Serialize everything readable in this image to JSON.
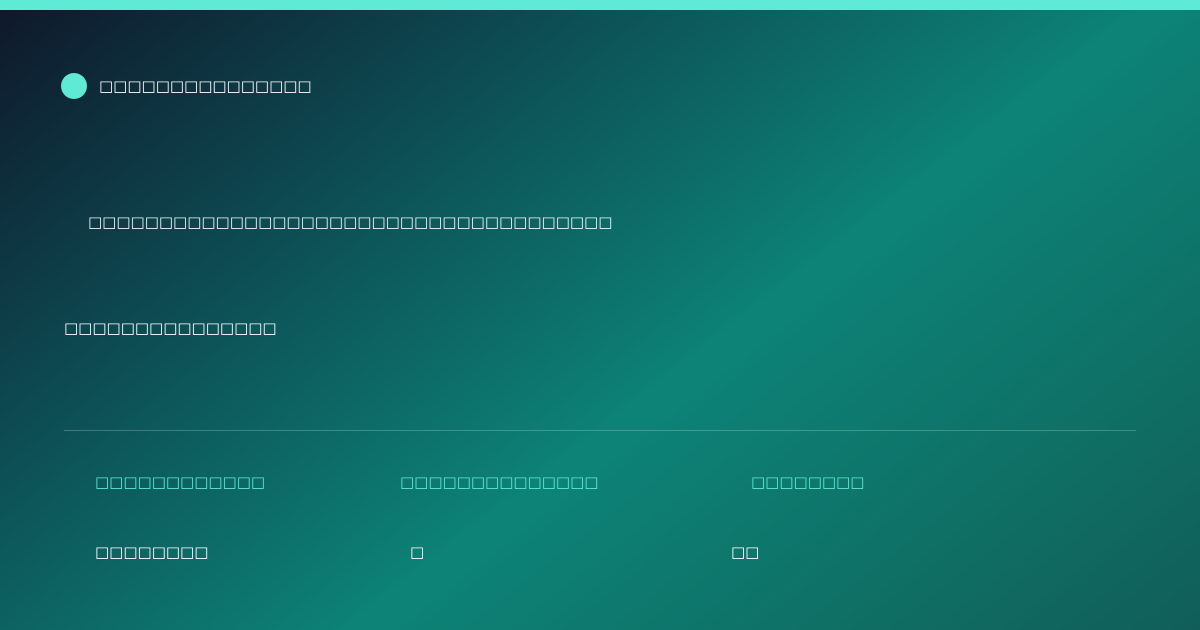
{
  "colors": {
    "accent": "#5eead4",
    "text": "#ffffff",
    "background_start": "#0f172a",
    "background_mid": "#0d8377",
    "background_end": "#115e59"
  },
  "brand": {
    "icon": "brand-dot-icon",
    "name": "□□□□□□□□□□□□□□□"
  },
  "headline": "□□□□□□□□□□□□□□□□□□□□□□□□□□□□□□□□□□□□□",
  "subline": "□□□□□□□□□□□□□□□",
  "stats": [
    {
      "label": "□□□□□□□□□□□□",
      "value": "□□□□□□□□"
    },
    {
      "label": "□□□□□□□□□□□□□□",
      "value": "□"
    },
    {
      "label": "□□□□□□□□",
      "value": "□□"
    }
  ]
}
